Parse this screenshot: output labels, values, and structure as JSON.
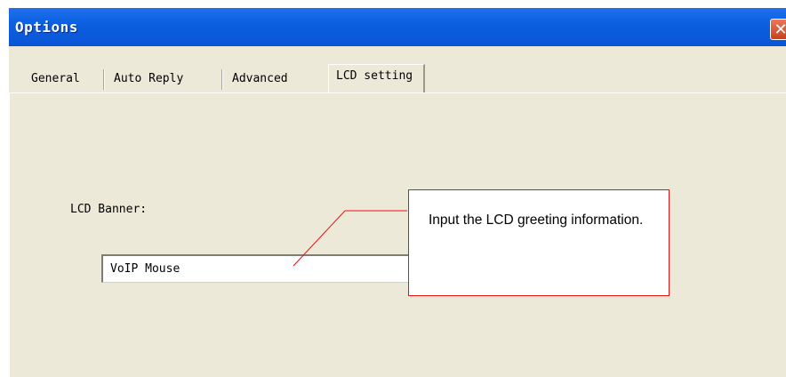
{
  "window": {
    "title": "Options",
    "close_glyph": "✕"
  },
  "tabs": [
    {
      "label": "General",
      "selected": false
    },
    {
      "label": "Auto Reply",
      "selected": false
    },
    {
      "label": "Advanced",
      "selected": false
    },
    {
      "label": "LCD setting",
      "selected": true
    }
  ],
  "lcd_setting": {
    "banner_label": "LCD Banner:",
    "banner_value": "VoIP Mouse"
  },
  "callout": {
    "text": "Input the LCD greeting information."
  },
  "colors": {
    "titlebar": "#0c5fe0",
    "panel_bg": "#ece9d8",
    "callout_border": "#ee1111",
    "close_button": "#d4573a"
  },
  "icons": [
    "close-icon"
  ]
}
